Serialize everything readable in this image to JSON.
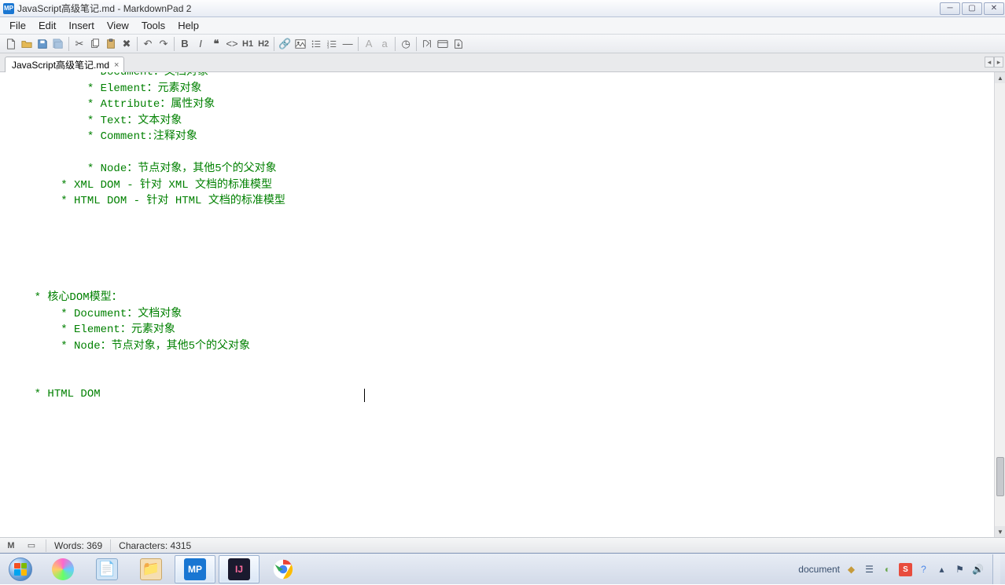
{
  "window": {
    "title": "JavaScript高级笔记.md - MarkdownPad 2",
    "app_short": "MP"
  },
  "menu": [
    "File",
    "Edit",
    "Insert",
    "View",
    "Tools",
    "Help"
  ],
  "toolbar": {
    "h1": "H1",
    "h2": "H2",
    "A_up": "A",
    "a_low": "a"
  },
  "tab": {
    "label": "JavaScript高级笔记.md",
    "close": "×"
  },
  "editor_lines": [
    {
      "indent": "            ",
      "bullet": "* ",
      "text": "Document：文档对象",
      "partial_top": true
    },
    {
      "indent": "            ",
      "bullet": "* ",
      "text": "Element：元素对象"
    },
    {
      "indent": "            ",
      "bullet": "* ",
      "text": "Attribute：属性对象"
    },
    {
      "indent": "            ",
      "bullet": "* ",
      "text": "Text：文本对象"
    },
    {
      "indent": "            ",
      "bullet": "* ",
      "text": "Comment:注释对象"
    },
    {
      "indent": "",
      "bullet": "",
      "text": ""
    },
    {
      "indent": "            ",
      "bullet": "* ",
      "text": "Node：节点对象，其他5个的父对象"
    },
    {
      "indent": "        ",
      "bullet": "* ",
      "text": "XML DOM - 针对 XML 文档的标准模型"
    },
    {
      "indent": "        ",
      "bullet": "* ",
      "text": "HTML DOM - 针对 HTML 文档的标准模型"
    },
    {
      "indent": "",
      "bullet": "",
      "text": ""
    },
    {
      "indent": "",
      "bullet": "",
      "text": ""
    },
    {
      "indent": "",
      "bullet": "",
      "text": ""
    },
    {
      "indent": "",
      "bullet": "",
      "text": ""
    },
    {
      "indent": "",
      "bullet": "",
      "text": ""
    },
    {
      "indent": "    ",
      "bullet": "* ",
      "text": "核心DOM模型："
    },
    {
      "indent": "        ",
      "bullet": "* ",
      "text": "Document：文档对象"
    },
    {
      "indent": "        ",
      "bullet": "* ",
      "text": "Element：元素对象"
    },
    {
      "indent": "        ",
      "bullet": "* ",
      "text": "Node：节点对象，其他5个的父对象"
    },
    {
      "indent": "",
      "bullet": "",
      "text": ""
    },
    {
      "indent": "",
      "bullet": "",
      "text": ""
    },
    {
      "indent": "    ",
      "bullet": "* ",
      "text": "HTML DOM"
    }
  ],
  "statusbar": {
    "words_label": "Words: ",
    "words": "369",
    "chars_label": "Characters: ",
    "chars": "4315"
  },
  "tray": {
    "ime": "document"
  }
}
